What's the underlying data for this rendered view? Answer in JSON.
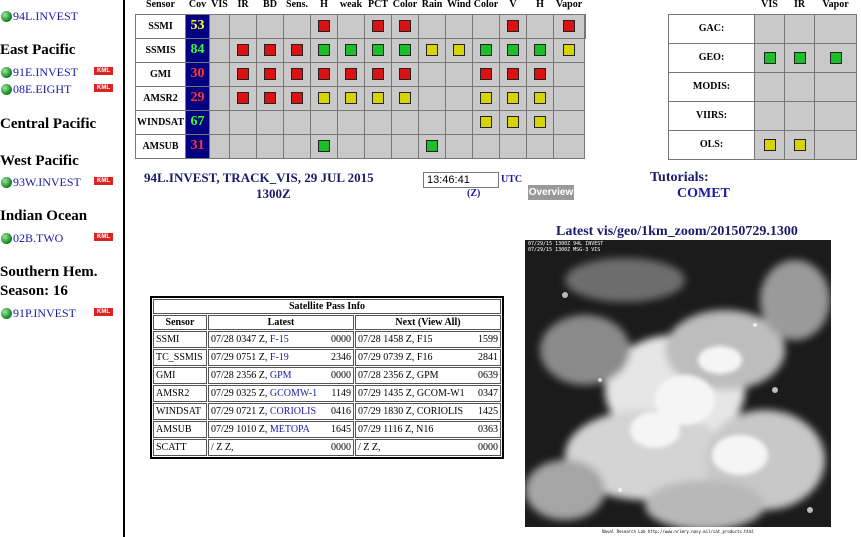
{
  "sidebar": {
    "top_storm": "94L.INVEST",
    "sections": [
      {
        "title": "East Pacific",
        "storms": [
          "91E.INVEST",
          "08E.EIGHT"
        ]
      },
      {
        "title": "Central Pacific",
        "storms": []
      },
      {
        "title": "West Pacific",
        "storms": [
          "93W.INVEST"
        ]
      },
      {
        "title": "Indian Ocean",
        "storms": [
          "02B.TWO"
        ]
      },
      {
        "title": "Southern Hem.",
        "season": "Season: 16",
        "storms": [
          "91P.INVEST"
        ]
      }
    ],
    "kml_label": "KML"
  },
  "sensor_grid": {
    "headers": [
      "Sensor",
      "Cov",
      "VIS",
      "IR",
      "BD",
      "Sens.",
      "H",
      "weak",
      "PCT",
      "Color",
      "Rain",
      "Wind",
      "Color",
      "V",
      "H",
      "Vapor"
    ],
    "rows": [
      {
        "name": "SSMI",
        "cov": "53",
        "cov_color": "#ffff33",
        "cells": [
          "",
          "",
          "",
          "",
          "r",
          "",
          "r",
          "r",
          "",
          "",
          "",
          "r",
          "",
          "r",
          ""
        ]
      },
      {
        "name": "SSMIS",
        "cov": "84",
        "cov_color": "#33ff33",
        "cells": [
          "",
          "r",
          "r",
          "r",
          "g",
          "g",
          "g",
          "g",
          "y",
          "y",
          "g",
          "g",
          "g",
          "y"
        ]
      },
      {
        "name": "GMI",
        "cov": "30",
        "cov_color": "#ff3333",
        "cells": [
          "",
          "r",
          "r",
          "r",
          "r",
          "r",
          "r",
          "r",
          "",
          "",
          "r",
          "r",
          "r",
          ""
        ]
      },
      {
        "name": "AMSR2",
        "cov": "29",
        "cov_color": "#ff3333",
        "cells": [
          "",
          "r",
          "r",
          "r",
          "y",
          "y",
          "y",
          "y",
          "",
          "",
          "y",
          "y",
          "y",
          ""
        ]
      },
      {
        "name": "WINDSAT",
        "cov": "67",
        "cov_color": "#33ff33",
        "cells": [
          "",
          "",
          "",
          "",
          "",
          "",
          "",
          "",
          "",
          "",
          "y",
          "y",
          "y",
          ""
        ]
      },
      {
        "name": "AMSUB",
        "cov": "31",
        "cov_color": "#ff3333",
        "cells": [
          "",
          "",
          "",
          "",
          "g",
          "",
          "",
          "",
          "g",
          "",
          "",
          "",
          "",
          ""
        ]
      }
    ]
  },
  "geo_grid": {
    "headers": [
      "VIS",
      "IR",
      "Vapor"
    ],
    "rows": [
      {
        "name": "GAC:",
        "cells": [
          "",
          "",
          ""
        ]
      },
      {
        "name": "GEO:",
        "cells": [
          "g",
          "g",
          "g"
        ]
      },
      {
        "name": "MODIS:",
        "cells": [
          "",
          "",
          ""
        ]
      },
      {
        "name": "VIIRS:",
        "cells": [
          "",
          "",
          ""
        ]
      },
      {
        "name": "OLS:",
        "cells": [
          "y",
          "y",
          ""
        ]
      }
    ]
  },
  "header": {
    "title_line1": "94L.INVEST, TRACK_VIS, 29 JUL 2015",
    "title_line2": "1300Z",
    "time_value": "13:46:41",
    "utc_label": "UTC",
    "z_label": "(Z)",
    "overview_label": "Overview",
    "tutorials_label": "Tutorials:",
    "comet_label": "COMET"
  },
  "pass_info": {
    "caption": "Satellite Pass Info",
    "col_sensor": "Sensor",
    "col_latest": "Latest",
    "col_next": "Next (View All)",
    "rows": [
      {
        "sensor": "SSMI",
        "latest": "07/28 0347 Z,",
        "latest_sat": "F-15",
        "latest_num": "0000",
        "next": "07/28 1458 Z,",
        "next_sat": "F15",
        "next_num": "1599"
      },
      {
        "sensor": "TC_SSMIS",
        "latest": "07/29 0751 Z,",
        "latest_sat": "F-19",
        "latest_num": "2346",
        "next": "07/29 0739 Z,",
        "next_sat": "F16",
        "next_num": "2841"
      },
      {
        "sensor": "GMI",
        "latest": "07/28 2356 Z,",
        "latest_sat": "GPM",
        "latest_num": "0000",
        "next": "07/28 2356 Z,",
        "next_sat": "GPM",
        "next_num": "0639"
      },
      {
        "sensor": "AMSR2",
        "latest": "07/29 0325 Z,",
        "latest_sat": "GCOMW-1",
        "latest_num": "1149",
        "next": "07/29 1435 Z,",
        "next_sat": "GCOM-W1",
        "next_num": "0347"
      },
      {
        "sensor": "WINDSAT",
        "latest": "07/29 0721 Z,",
        "latest_sat": "CORIOLIS",
        "latest_num": "0416",
        "next": "07/29 1830 Z,",
        "next_sat": "CORIOLIS",
        "next_num": "1425"
      },
      {
        "sensor": "AMSUB",
        "latest": "07/29 1010 Z,",
        "latest_sat": "METOPA",
        "latest_num": "1645",
        "next": "07/29 1116 Z,",
        "next_sat": "N16",
        "next_num": "0363"
      },
      {
        "sensor": "SCATT",
        "latest": "/ Z Z,",
        "latest_sat": "",
        "latest_num": "0000",
        "next": "/ Z Z,",
        "next_sat": "",
        "next_num": "0000"
      }
    ]
  },
  "image": {
    "title": "Latest vis/geo/1km_zoom/20150729.1300",
    "overlay_line1": "07/29/15 1300Z  94L INVEST",
    "overlay_line2": "07/29/15 1300Z  MSG-3 VIS",
    "footer": "Naval Research Lab http://www.nrlmry.navy.mil/sat_products.html"
  },
  "colors": {
    "red": "#dd1111",
    "green": "#1bbf2a",
    "yellow": "#d8d400",
    "cov_bg": "#000080",
    "link": "#1a1aa6"
  }
}
